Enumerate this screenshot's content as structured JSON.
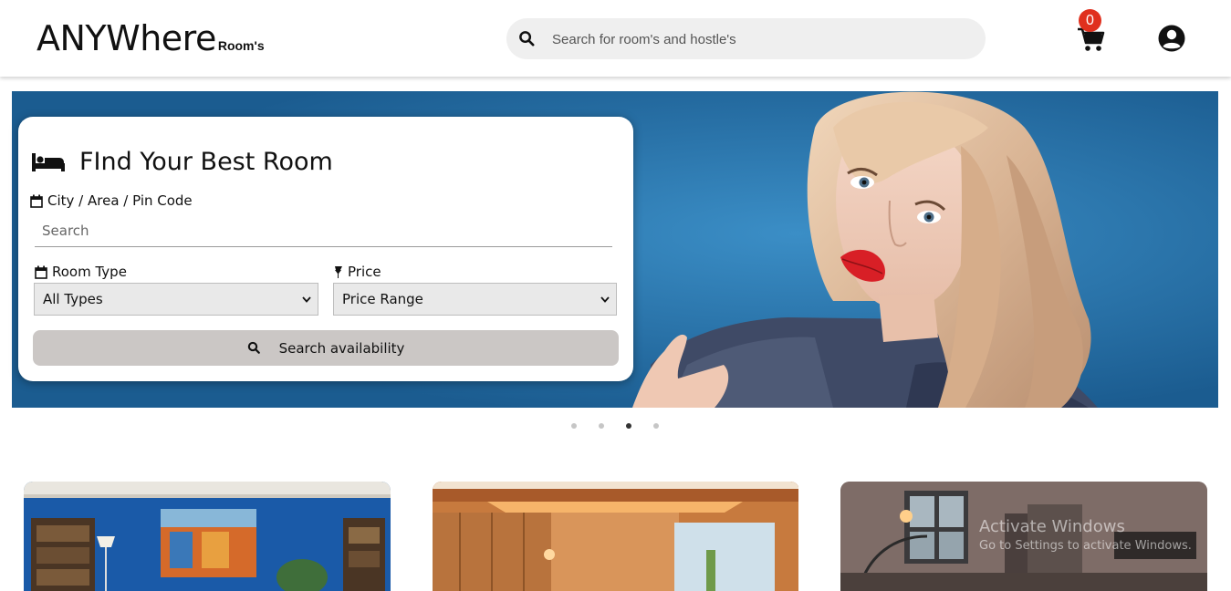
{
  "header": {
    "logo_main": "ANYWhere",
    "logo_sub": "Room's",
    "search_placeholder": "Search for room's and hostle's",
    "cart_count": "0"
  },
  "finder": {
    "title": "FInd Your Best Room",
    "location_label": "City / Area / Pin Code",
    "location_placeholder": "Search",
    "room_type_label": "Room Type",
    "room_type_value": "All Types",
    "price_label": "Price",
    "price_value": "Price Range",
    "search_button": "Search availability"
  },
  "carousel": {
    "slide_count": 4,
    "active_index": 2
  },
  "watermark": {
    "line1": "Activate Windows",
    "line2": "Go to Settings to activate Windows."
  },
  "colors": {
    "badge": "#e0301e",
    "hero_bg": "#1f6aa3",
    "search_button": "#cbc7c5"
  }
}
